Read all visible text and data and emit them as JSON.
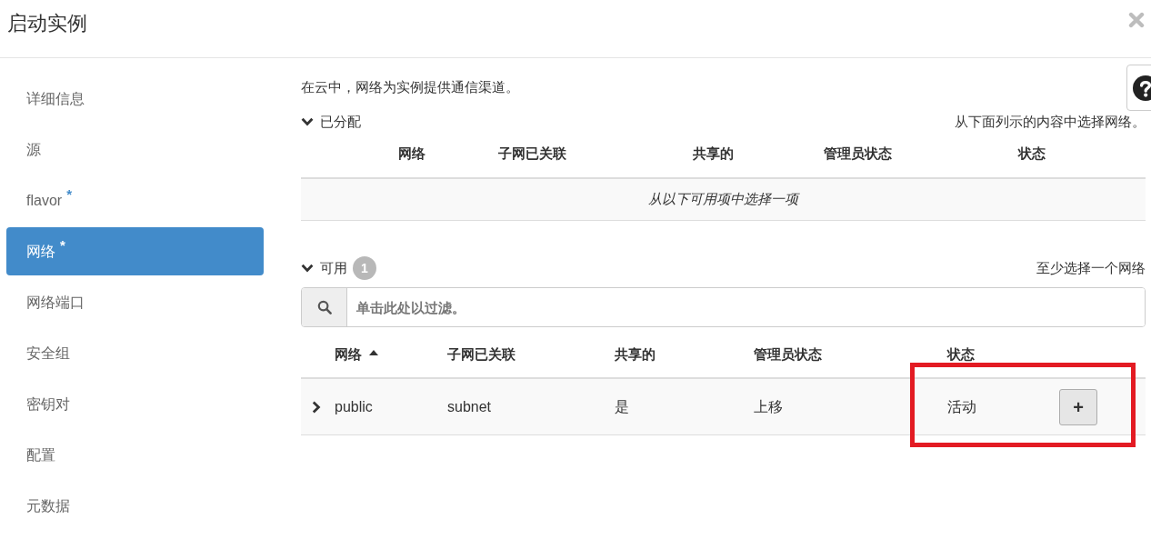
{
  "dialog": {
    "title": "启动实例"
  },
  "sidebar": {
    "items": [
      {
        "label": "详细信息",
        "selected": false
      },
      {
        "label": "源",
        "selected": false
      },
      {
        "label": "flavor",
        "mark": "*",
        "selected": false
      },
      {
        "label": "网络",
        "mark": "*",
        "selected": true
      },
      {
        "label": "网络端口",
        "selected": false
      },
      {
        "label": "安全组",
        "selected": false
      },
      {
        "label": "密钥对",
        "selected": false
      },
      {
        "label": "配置",
        "selected": false
      },
      {
        "label": "元数据",
        "selected": false
      }
    ]
  },
  "panel": {
    "description": "在云中，网络为实例提供通信渠道。",
    "allocated": {
      "title": "已分配",
      "expanded": true,
      "hint": "从下面列示的内容中选择网络。",
      "columns": [
        "网络",
        "子网已关联",
        "共享的",
        "管理员状态",
        "状态"
      ],
      "empty_message": "从以下可用项中选择一项"
    },
    "available": {
      "title": "可用",
      "expanded": true,
      "count": "1",
      "hint": "至少选择一个网络",
      "filter": {
        "placeholder": "单击此处以过滤。"
      },
      "columns": [
        {
          "label": "网络",
          "sorted": true
        },
        {
          "label": "子网已关联",
          "sorted": false
        },
        {
          "label": "共享的",
          "sorted": false
        },
        {
          "label": "管理员状态",
          "sorted": false
        },
        {
          "label": "状态",
          "sorted": false
        }
      ],
      "rows": [
        {
          "expanded": false,
          "cells": [
            "public",
            "subnet",
            "是",
            "上移",
            "活动"
          ],
          "action": "+"
        }
      ]
    }
  },
  "annotations": [
    {
      "kind": "frame"
    }
  ]
}
